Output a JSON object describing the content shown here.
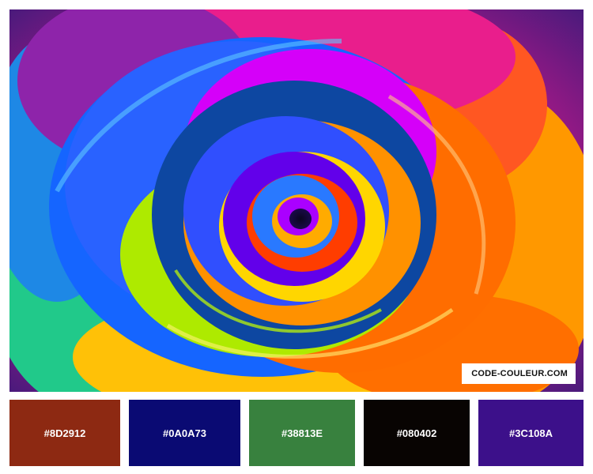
{
  "watermark": "CODE-COULEUR.COM",
  "palette": [
    {
      "hex": "#8D2912"
    },
    {
      "hex": "#0A0A73"
    },
    {
      "hex": "#38813E"
    },
    {
      "hex": "#080402"
    },
    {
      "hex": "#3C108A"
    }
  ]
}
